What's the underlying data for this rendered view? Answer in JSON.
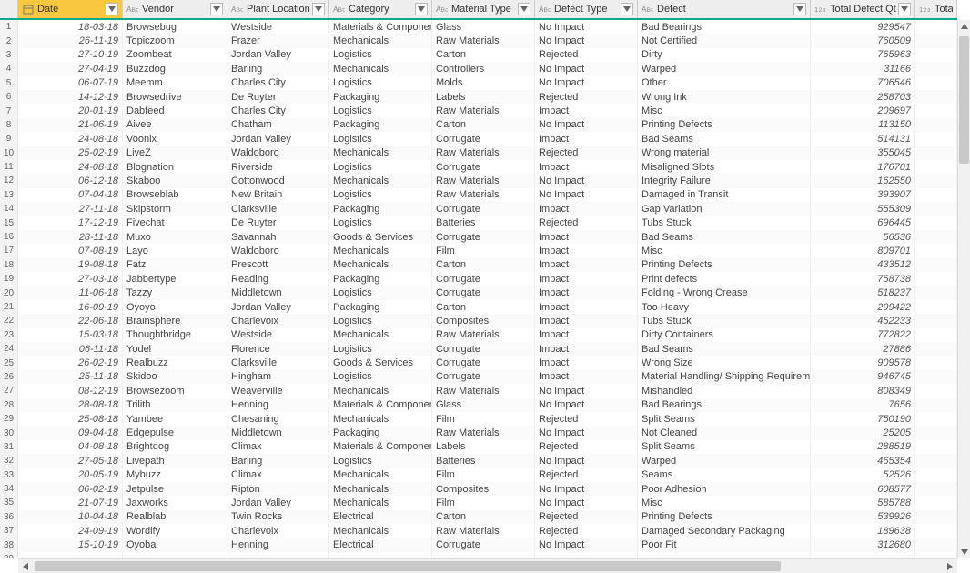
{
  "columns": {
    "date": {
      "label": "Date",
      "type": "date"
    },
    "vendor": {
      "label": "Vendor",
      "type": "text"
    },
    "plant": {
      "label": "Plant Location",
      "type": "text"
    },
    "cat": {
      "label": "Category",
      "type": "text"
    },
    "mat": {
      "label": "Material Type",
      "type": "text"
    },
    "deftype": {
      "label": "Defect Type",
      "type": "text"
    },
    "defect": {
      "label": "Defect",
      "type": "text"
    },
    "qty": {
      "label": "Total Defect Qty",
      "type": "num"
    },
    "dov": {
      "label": "Total Dov",
      "type": "num"
    }
  },
  "rows": [
    {
      "n": 1,
      "date": "18-03-18",
      "vendor": "Browsebug",
      "plant": "Westside",
      "cat": "Materials & Components",
      "mat": "Glass",
      "deftype": "No Impact",
      "defect": "Bad Bearings",
      "qty": "929547"
    },
    {
      "n": 2,
      "date": "26-11-19",
      "vendor": "Topiczoom",
      "plant": "Frazer",
      "cat": "Mechanicals",
      "mat": "Raw Materials",
      "deftype": "No Impact",
      "defect": "Not Certified",
      "qty": "760509"
    },
    {
      "n": 3,
      "date": "27-10-19",
      "vendor": "Zoombeat",
      "plant": "Jordan Valley",
      "cat": "Logistics",
      "mat": "Carton",
      "deftype": "Rejected",
      "defect": "Dirty",
      "qty": "765963"
    },
    {
      "n": 4,
      "date": "27-04-19",
      "vendor": "Buzzdog",
      "plant": "Barling",
      "cat": "Mechanicals",
      "mat": "Controllers",
      "deftype": "No Impact",
      "defect": "Warped",
      "qty": "31166"
    },
    {
      "n": 5,
      "date": "06-07-19",
      "vendor": "Meemm",
      "plant": "Charles City",
      "cat": "Logistics",
      "mat": "Molds",
      "deftype": "No Impact",
      "defect": "Other",
      "qty": "706546"
    },
    {
      "n": 6,
      "date": "14-12-19",
      "vendor": "Browsedrive",
      "plant": "De Ruyter",
      "cat": "Packaging",
      "mat": "Labels",
      "deftype": "Rejected",
      "defect": "Wrong Ink",
      "qty": "258703"
    },
    {
      "n": 7,
      "date": "20-01-19",
      "vendor": "Dabfeed",
      "plant": "Charles City",
      "cat": "Logistics",
      "mat": "Raw Materials",
      "deftype": "Impact",
      "defect": "Misc",
      "qty": "209697"
    },
    {
      "n": 8,
      "date": "21-06-19",
      "vendor": "Aivee",
      "plant": "Chatham",
      "cat": "Packaging",
      "mat": "Carton",
      "deftype": "No Impact",
      "defect": "Printing Defects",
      "qty": "113150"
    },
    {
      "n": 9,
      "date": "24-08-18",
      "vendor": "Voonix",
      "plant": "Jordan Valley",
      "cat": "Logistics",
      "mat": "Corrugate",
      "deftype": "Impact",
      "defect": "Bad Seams",
      "qty": "514131"
    },
    {
      "n": 10,
      "date": "25-02-19",
      "vendor": "LiveZ",
      "plant": "Waldoboro",
      "cat": "Mechanicals",
      "mat": "Raw Materials",
      "deftype": "Rejected",
      "defect": "Wrong material",
      "qty": "355045"
    },
    {
      "n": 11,
      "date": "24-08-18",
      "vendor": "Blognation",
      "plant": "Riverside",
      "cat": "Logistics",
      "mat": "Corrugate",
      "deftype": "Impact",
      "defect": "Misaligned Slots",
      "qty": "176701"
    },
    {
      "n": 12,
      "date": "06-12-18",
      "vendor": "Skaboo",
      "plant": "Cottonwood",
      "cat": "Mechanicals",
      "mat": "Raw Materials",
      "deftype": "No Impact",
      "defect": "Integrity Failure",
      "qty": "162550"
    },
    {
      "n": 13,
      "date": "07-04-18",
      "vendor": "Browseblab",
      "plant": "New Britain",
      "cat": "Logistics",
      "mat": "Raw Materials",
      "deftype": "No Impact",
      "defect": "Damaged in Transit",
      "qty": "393907"
    },
    {
      "n": 14,
      "date": "27-11-18",
      "vendor": "Skipstorm",
      "plant": "Clarksville",
      "cat": "Packaging",
      "mat": "Corrugate",
      "deftype": "Impact",
      "defect": "Gap Variation",
      "qty": "555309"
    },
    {
      "n": 15,
      "date": "17-12-19",
      "vendor": "Fivechat",
      "plant": "De Ruyter",
      "cat": "Logistics",
      "mat": "Batteries",
      "deftype": "Rejected",
      "defect": "Tubs Stuck",
      "qty": "696445"
    },
    {
      "n": 16,
      "date": "28-11-18",
      "vendor": "Muxo",
      "plant": "Savannah",
      "cat": "Goods & Services",
      "mat": "Corrugate",
      "deftype": "Impact",
      "defect": "Bad Seams",
      "qty": "56536"
    },
    {
      "n": 17,
      "date": "07-08-19",
      "vendor": "Layo",
      "plant": "Waldoboro",
      "cat": "Mechanicals",
      "mat": "Film",
      "deftype": "Impact",
      "defect": "Misc",
      "qty": "809701"
    },
    {
      "n": 18,
      "date": "19-08-18",
      "vendor": "Fatz",
      "plant": "Prescott",
      "cat": "Mechanicals",
      "mat": "Carton",
      "deftype": "Impact",
      "defect": "Printing Defects",
      "qty": "433512"
    },
    {
      "n": 19,
      "date": "27-03-18",
      "vendor": "Jabbertype",
      "plant": "Reading",
      "cat": "Packaging",
      "mat": "Corrugate",
      "deftype": "Impact",
      "defect": "Print defects",
      "qty": "758738"
    },
    {
      "n": 20,
      "date": "11-06-18",
      "vendor": "Tazzy",
      "plant": "Middletown",
      "cat": "Logistics",
      "mat": "Corrugate",
      "deftype": "Impact",
      "defect": "Folding - Wrong Crease",
      "qty": "518237"
    },
    {
      "n": 21,
      "date": "16-09-19",
      "vendor": "Oyoyo",
      "plant": "Jordan Valley",
      "cat": "Packaging",
      "mat": "Carton",
      "deftype": "Impact",
      "defect": "Too Heavy",
      "qty": "299422"
    },
    {
      "n": 22,
      "date": "22-06-18",
      "vendor": "Brainsphere",
      "plant": "Charlevoix",
      "cat": "Logistics",
      "mat": "Composites",
      "deftype": "Impact",
      "defect": "Tubs Stuck",
      "qty": "452233"
    },
    {
      "n": 23,
      "date": "15-03-18",
      "vendor": "Thoughtbridge",
      "plant": "Westside",
      "cat": "Mechanicals",
      "mat": "Raw Materials",
      "deftype": "Impact",
      "defect": "Dirty Containers",
      "qty": "772822"
    },
    {
      "n": 24,
      "date": "06-11-18",
      "vendor": "Yodel",
      "plant": "Florence",
      "cat": "Logistics",
      "mat": "Corrugate",
      "deftype": "Impact",
      "defect": "Bad Seams",
      "qty": "27886"
    },
    {
      "n": 25,
      "date": "26-02-19",
      "vendor": "Realbuzz",
      "plant": "Clarksville",
      "cat": "Goods & Services",
      "mat": "Corrugate",
      "deftype": "Impact",
      "defect": "Wrong  Size",
      "qty": "909578"
    },
    {
      "n": 26,
      "date": "25-11-18",
      "vendor": "Skidoo",
      "plant": "Hingham",
      "cat": "Logistics",
      "mat": "Corrugate",
      "deftype": "Impact",
      "defect": "Material Handling/ Shipping Requirements Error",
      "qty": "946745"
    },
    {
      "n": 27,
      "date": "08-12-19",
      "vendor": "Browsezoom",
      "plant": "Weaverville",
      "cat": "Mechanicals",
      "mat": "Raw Materials",
      "deftype": "No Impact",
      "defect": "Mishandled",
      "qty": "808349"
    },
    {
      "n": 28,
      "date": "28-08-18",
      "vendor": "Trilith",
      "plant": "Henning",
      "cat": "Materials & Components",
      "mat": "Glass",
      "deftype": "No Impact",
      "defect": "Bad Bearings",
      "qty": "7656"
    },
    {
      "n": 29,
      "date": "25-08-18",
      "vendor": "Yambee",
      "plant": "Chesaning",
      "cat": "Mechanicals",
      "mat": "Film",
      "deftype": "Rejected",
      "defect": "Split Seams",
      "qty": "750190"
    },
    {
      "n": 30,
      "date": "09-04-18",
      "vendor": "Edgepulse",
      "plant": "Middletown",
      "cat": "Packaging",
      "mat": "Raw Materials",
      "deftype": "No Impact",
      "defect": "Not Cleaned",
      "qty": "25205"
    },
    {
      "n": 31,
      "date": "04-08-18",
      "vendor": "Brightdog",
      "plant": "Climax",
      "cat": "Materials & Components",
      "mat": "Labels",
      "deftype": "Rejected",
      "defect": "Split Seams",
      "qty": "288519"
    },
    {
      "n": 32,
      "date": "27-05-18",
      "vendor": "Livepath",
      "plant": "Barling",
      "cat": "Logistics",
      "mat": "Batteries",
      "deftype": "No Impact",
      "defect": "Warped",
      "qty": "465354"
    },
    {
      "n": 33,
      "date": "20-05-19",
      "vendor": "Mybuzz",
      "plant": "Climax",
      "cat": "Mechanicals",
      "mat": "Film",
      "deftype": "Rejected",
      "defect": "Seams",
      "qty": "52526"
    },
    {
      "n": 34,
      "date": "06-02-19",
      "vendor": "Jetpulse",
      "plant": "Ripton",
      "cat": "Mechanicals",
      "mat": "Composites",
      "deftype": "No Impact",
      "defect": "Poor  Adhesion",
      "qty": "608577"
    },
    {
      "n": 35,
      "date": "21-07-19",
      "vendor": "Jaxworks",
      "plant": "Jordan Valley",
      "cat": "Mechanicals",
      "mat": "Film",
      "deftype": "No Impact",
      "defect": "Misc",
      "qty": "585788"
    },
    {
      "n": 36,
      "date": "10-04-18",
      "vendor": "Realblab",
      "plant": "Twin Rocks",
      "cat": "Electrical",
      "mat": "Carton",
      "deftype": "Rejected",
      "defect": "Printing Defects",
      "qty": "539926"
    },
    {
      "n": 37,
      "date": "24-09-19",
      "vendor": "Wordify",
      "plant": "Charlevoix",
      "cat": "Mechanicals",
      "mat": "Raw Materials",
      "deftype": "Rejected",
      "defect": "Damaged Secondary Packaging",
      "qty": "189638"
    },
    {
      "n": 38,
      "date": "15-10-19",
      "vendor": "Oyoba",
      "plant": "Henning",
      "cat": "Electrical",
      "mat": "Corrugate",
      "deftype": "No Impact",
      "defect": "Poor Fit",
      "qty": "312680"
    },
    {
      "n": 39,
      "date": "",
      "vendor": "",
      "plant": "",
      "cat": "",
      "mat": "",
      "deftype": "",
      "defect": "",
      "qty": ""
    }
  ]
}
